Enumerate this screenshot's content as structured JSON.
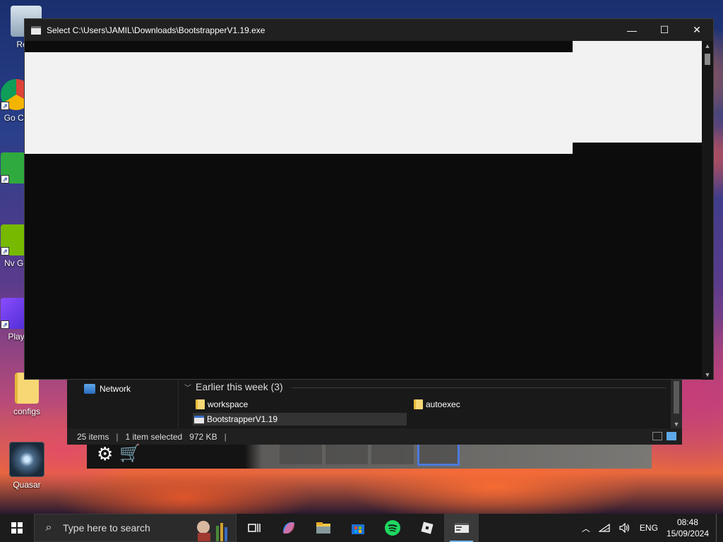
{
  "desktop": {
    "icons": [
      {
        "label": "Recy",
        "icon": "recycle-bin-icon"
      },
      {
        "label": "Go Ch",
        "icon": "chrome-icon"
      },
      {
        "label": "",
        "icon": "app-shortcut-icon"
      },
      {
        "label": "Nv Ge",
        "icon": "nvidia-icon"
      },
      {
        "label": "Play",
        "icon": "play-app-icon"
      },
      {
        "label": "configs",
        "icon": "folder-icon"
      },
      {
        "label": "Quasar",
        "icon": "quasar-icon"
      }
    ]
  },
  "console": {
    "title": "Select C:\\Users\\JAMIL\\Downloads\\BootstrapperV1.19.exe",
    "buttons": {
      "minimize": "—",
      "maximize": "☐",
      "close": "✕"
    }
  },
  "explorer": {
    "nav": {
      "network": "Network"
    },
    "group_header": "Earlier this week (3)",
    "files": [
      {
        "name": "workspace",
        "type": "folder"
      },
      {
        "name": "autoexec",
        "type": "folder"
      },
      {
        "name": "BootstrapperV1.19",
        "type": "exe",
        "selected": true
      }
    ],
    "status": {
      "items": "25 items",
      "selected": "1 item selected",
      "size": "972 KB"
    }
  },
  "taskbar": {
    "search_placeholder": "Type here to search",
    "apps": [
      "task-view",
      "copilot",
      "file-explorer",
      "microsoft-store",
      "spotify",
      "roblox",
      "terminal-console"
    ],
    "tray": {
      "language": "ENG",
      "time": "08:48",
      "date": "15/09/2024"
    }
  }
}
